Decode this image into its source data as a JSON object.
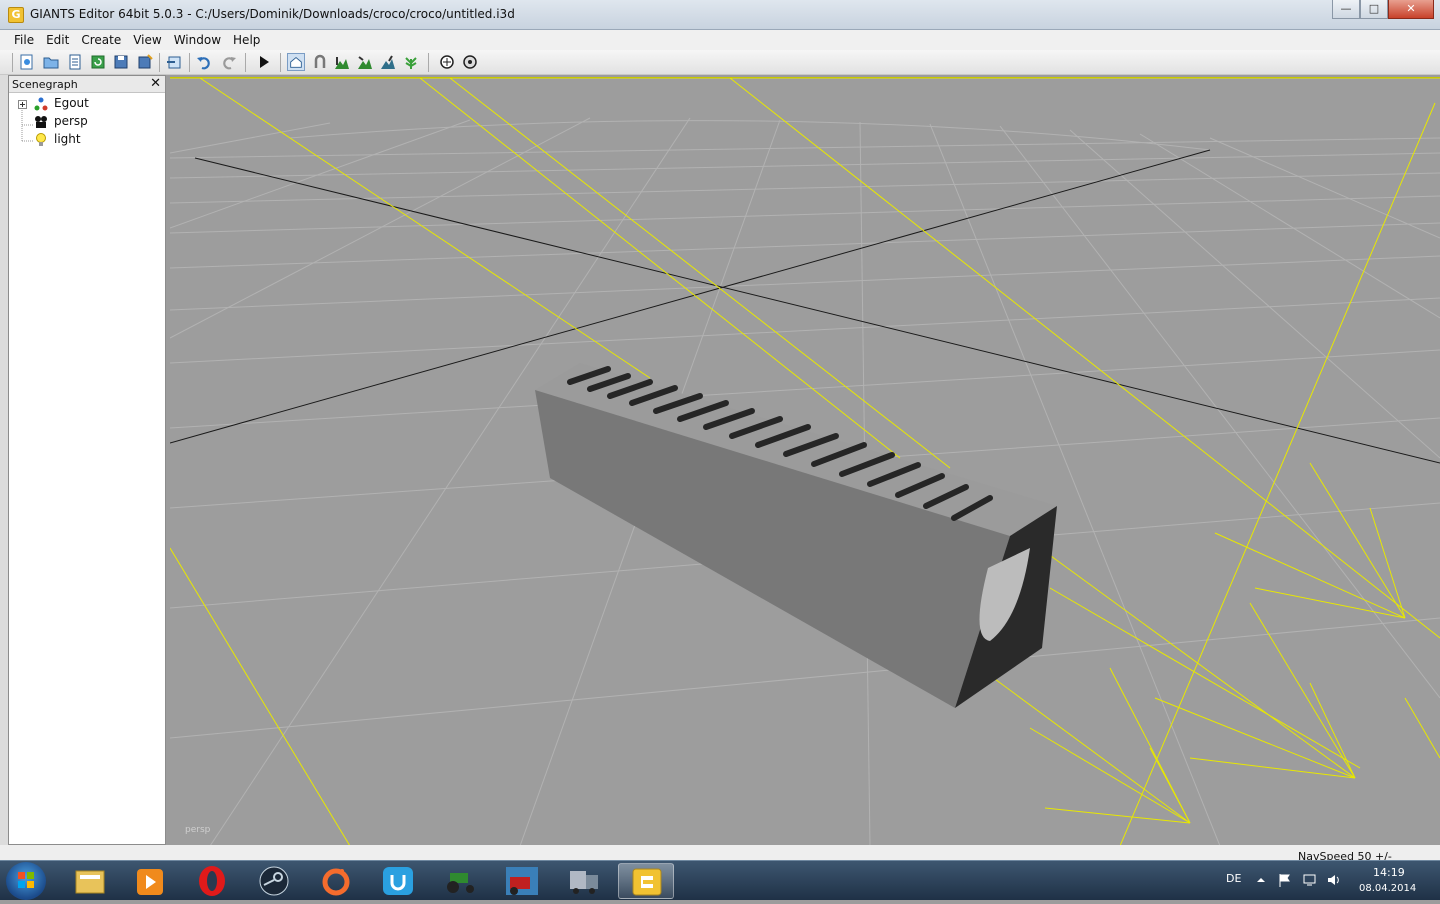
{
  "window": {
    "title": "GIANTS Editor 64bit 5.0.3 - C:/Users/Dominik/Downloads/croco/croco/untitled.i3d",
    "app_icon": "giants-g-icon",
    "buttons": {
      "minimize": "—",
      "maximize": "□",
      "close": "✕"
    }
  },
  "menu": {
    "items": [
      "File",
      "Edit",
      "Create",
      "View",
      "Window",
      "Help"
    ]
  },
  "toolbar": {
    "icons": [
      "new-icon",
      "open-icon",
      "properties-icon",
      "refresh-icon",
      "save-icon",
      "save-as-icon",
      "import-icon",
      "undo-icon",
      "redo-icon",
      "play-icon",
      "home-view-icon",
      "magnet-icon",
      "terrain-sculpt-icon",
      "terrain-paint-icon",
      "terrain-paint-alt-icon",
      "foliage-paint-icon",
      "render-settings-icon",
      "render-preview-icon"
    ]
  },
  "scenegraph": {
    "title": "Scenegraph",
    "close_label": "✕",
    "nodes": [
      {
        "label": "Egout",
        "icon": "transform-group-icon",
        "expandable": true
      },
      {
        "label": "persp",
        "icon": "camera-icon",
        "expandable": false
      },
      {
        "label": "light",
        "icon": "light-bulb-icon",
        "expandable": false
      }
    ]
  },
  "viewport": {
    "camera_label": "persp",
    "grid_color": "#b4b4b4",
    "axis_color": "#1a1a1a",
    "light_line_color": "#e8e800",
    "model": "drain channel with grated top"
  },
  "status": {
    "navspeed": "NavSpeed 50 +/-"
  },
  "taskbar": {
    "apps": [
      "start-orb-icon",
      "file-explorer-icon",
      "media-player-icon",
      "opera-icon",
      "steam-icon",
      "origin-icon",
      "uplay-icon",
      "farming-simulator-tractor-icon",
      "farming-simulator-icon",
      "euro-truck-simulator-icon",
      "giants-editor-icon"
    ],
    "language": "DE",
    "time": "14:19",
    "date": "08.04.2014"
  }
}
